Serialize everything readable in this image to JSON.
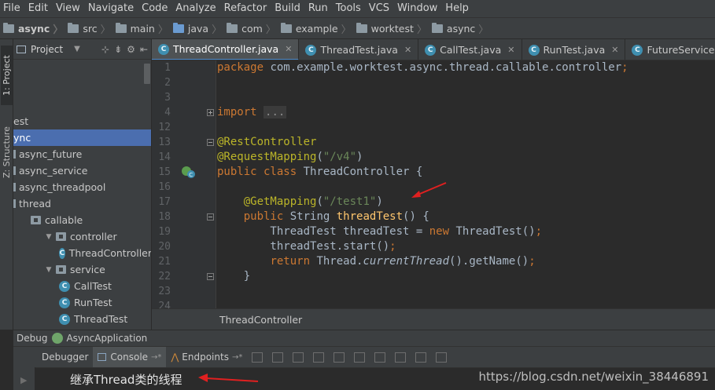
{
  "menu": [
    "File",
    "Edit",
    "View",
    "Navigate",
    "Code",
    "Analyze",
    "Refactor",
    "Build",
    "Run",
    "Tools",
    "VCS",
    "Window",
    "Help"
  ],
  "breadcrumb": [
    "async",
    "src",
    "main",
    "java",
    "com",
    "example",
    "worktest",
    "async"
  ],
  "toolwindows": {
    "project": "1: Project",
    "structure": "Z: Structure"
  },
  "project_panel": {
    "title": "Project",
    "tree": [
      {
        "label": "est",
        "indent": 0,
        "kind": "text"
      },
      {
        "label": "ync",
        "indent": 0,
        "kind": "text",
        "selected": true
      },
      {
        "label": "async_future",
        "indent": 0,
        "kind": "module"
      },
      {
        "label": "async_service",
        "indent": 0,
        "kind": "module"
      },
      {
        "label": "async_threadpool",
        "indent": 0,
        "kind": "module"
      },
      {
        "label": "thread",
        "indent": 0,
        "kind": "module"
      },
      {
        "label": "callable",
        "indent": 1,
        "kind": "package"
      },
      {
        "label": "controller",
        "indent": 2,
        "kind": "package",
        "expanded": true
      },
      {
        "label": "ThreadController",
        "indent": 3,
        "kind": "class"
      },
      {
        "label": "service",
        "indent": 2,
        "kind": "package",
        "expanded": true
      },
      {
        "label": "CallTest",
        "indent": 3,
        "kind": "class"
      },
      {
        "label": "RunTest",
        "indent": 3,
        "kind": "class"
      },
      {
        "label": "ThreadTest",
        "indent": 3,
        "kind": "class"
      }
    ]
  },
  "tabs": [
    "ThreadController.java",
    "ThreadTest.java",
    "CallTest.java",
    "RunTest.java",
    "FutureService.java"
  ],
  "active_tab": 0,
  "editor": {
    "lines": [
      {
        "n": "1",
        "segs": [
          [
            "kw",
            "package "
          ],
          [
            "id",
            "com.example.worktest.async.thread.callable.controller"
          ],
          [
            "kw",
            ";"
          ]
        ]
      },
      {
        "n": "2",
        "segs": []
      },
      {
        "n": "3",
        "segs": []
      },
      {
        "n": "4",
        "fold": "plus",
        "segs": [
          [
            "kw",
            "import "
          ],
          [
            "col",
            "..."
          ]
        ]
      },
      {
        "n": "12",
        "segs": []
      },
      {
        "n": "13",
        "fold": "minus",
        "segs": [
          [
            "an",
            "@RestController"
          ]
        ]
      },
      {
        "n": "14",
        "segs": [
          [
            "an",
            "@RequestMapping"
          ],
          [
            "id",
            "("
          ],
          [
            "st",
            "\"/v4\""
          ],
          [
            "id",
            ")"
          ]
        ]
      },
      {
        "n": "15",
        "run": true,
        "segs": [
          [
            "kw",
            "public class "
          ],
          [
            "id",
            "ThreadController {"
          ]
        ]
      },
      {
        "n": "16",
        "segs": []
      },
      {
        "n": "17",
        "segs": [
          [
            "id",
            "    "
          ],
          [
            "an",
            "@GetMapping"
          ],
          [
            "id",
            "("
          ],
          [
            "st",
            "\"/test1\""
          ],
          [
            "id",
            ")"
          ]
        ]
      },
      {
        "n": "18",
        "fold": "minus",
        "segs": [
          [
            "id",
            "    "
          ],
          [
            "kw",
            "public "
          ],
          [
            "id",
            "String "
          ],
          [
            "mt",
            "threadTest"
          ],
          [
            "id",
            "() {"
          ]
        ]
      },
      {
        "n": "19",
        "segs": [
          [
            "id",
            "        ThreadTest threadTest = "
          ],
          [
            "kw",
            "new "
          ],
          [
            "id",
            "ThreadTest()"
          ],
          [
            "kw",
            ";"
          ]
        ]
      },
      {
        "n": "20",
        "segs": [
          [
            "id",
            "        threadTest.start()"
          ],
          [
            "kw",
            ";"
          ]
        ]
      },
      {
        "n": "21",
        "segs": [
          [
            "id",
            "        "
          ],
          [
            "kw",
            "return "
          ],
          [
            "id",
            "Thread."
          ],
          [
            "it",
            "currentThread"
          ],
          [
            "id",
            "().getName()"
          ],
          [
            "kw",
            ";"
          ]
        ]
      },
      {
        "n": "22",
        "fold": "minus",
        "segs": [
          [
            "id",
            "    }"
          ]
        ]
      },
      {
        "n": "23",
        "segs": []
      },
      {
        "n": "24",
        "segs": []
      }
    ]
  },
  "editor_breadcrumb": "ThreadController",
  "debug": {
    "label": "Debug",
    "config": "AsyncApplication",
    "tabs": [
      "Debugger",
      "Console",
      "Endpoints"
    ],
    "active_tab": 1,
    "console_output": "继承Thread类的线程"
  },
  "watermark": "https://blog.csdn.net/weixin_38446891",
  "colors": {
    "keyword": "#cc7832",
    "annotation": "#bbb529",
    "string": "#6a8759",
    "identifier": "#a9b7c6",
    "method": "#ffc66d",
    "annotation_arrow": "#e02020",
    "selection": "#4b6eaf"
  }
}
